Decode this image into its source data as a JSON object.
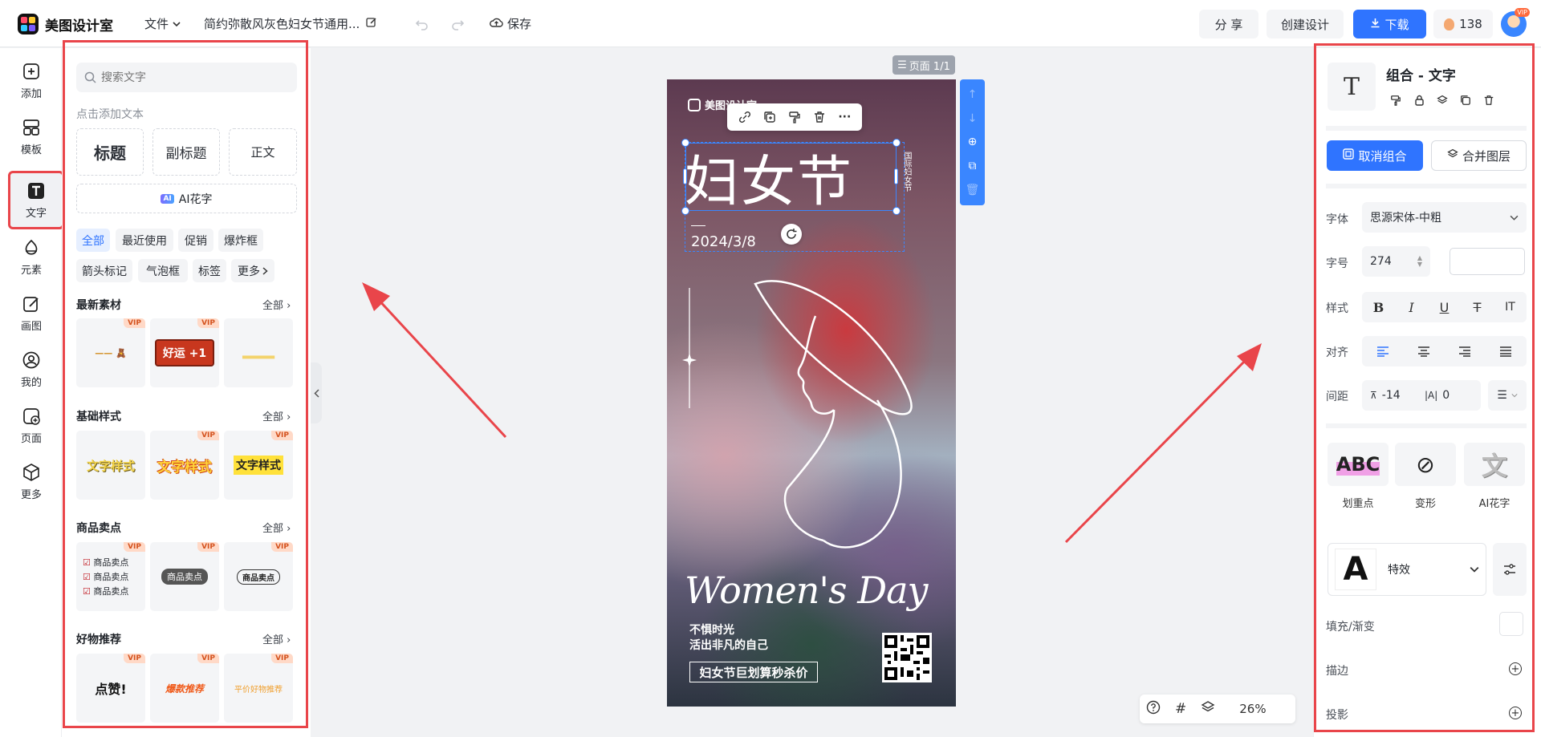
{
  "app": {
    "name": "美图设计室",
    "doc_title": "简约弥散风灰色妇女节通用...",
    "file_menu": "文件",
    "save": "保存"
  },
  "header": {
    "share": "分 享",
    "create": "创建设计",
    "download": "下载",
    "coins": "138",
    "avatar_badge": "VIP"
  },
  "rail": [
    {
      "label": "添加",
      "icon": "plus-square-icon"
    },
    {
      "label": "模板",
      "icon": "template-icon"
    },
    {
      "label": "文字",
      "icon": "text-icon",
      "active": true
    },
    {
      "label": "元素",
      "icon": "shapes-icon"
    },
    {
      "label": "画图",
      "icon": "pen-icon"
    },
    {
      "label": "我的",
      "icon": "user-icon"
    },
    {
      "label": "页面",
      "icon": "page-icon"
    },
    {
      "label": "更多",
      "icon": "box-icon"
    }
  ],
  "text_panel": {
    "search_placeholder": "搜索文字",
    "hint": "点击添加文本",
    "title_btn": "标题",
    "subtitle_btn": "副标题",
    "body_btn": "正文",
    "ai_tag": "AI",
    "ai_btn": "AI花字",
    "chips": [
      "全部",
      "最近使用",
      "促销",
      "爆炸框",
      "箭头标记",
      "气泡框",
      "标签",
      "更多"
    ],
    "sections": [
      {
        "title": "最新素材",
        "all": "全部",
        "tiles": [
          {
            "text": "",
            "vip": "VIP"
          },
          {
            "text": "好运 +1",
            "vip": "VIP"
          },
          {
            "text": ""
          }
        ]
      },
      {
        "title": "基础样式",
        "all": "全部",
        "tiles": [
          {
            "text": "文字样式"
          },
          {
            "text": "文字样式",
            "vip": "VIP"
          },
          {
            "text": "文字样式",
            "vip": "VIP"
          }
        ]
      },
      {
        "title": "商品卖点",
        "all": "全部",
        "tiles": [
          {
            "lines": [
              "商品卖点",
              "商品卖点",
              "商品卖点"
            ],
            "vip": "VIP"
          },
          {
            "text": "商品卖点",
            "vip": "VIP"
          },
          {
            "text": "商品卖点",
            "vip": "VIP"
          }
        ]
      },
      {
        "title": "好物推荐",
        "all": "全部",
        "tiles": [
          {
            "text": "点赞!",
            "vip": "VIP"
          },
          {
            "text": "爆款推荐",
            "vip": "VIP"
          },
          {
            "text": "平价好物推荐",
            "vip": "VIP"
          }
        ]
      }
    ]
  },
  "canvas": {
    "page_indicator": "页面 1/1",
    "zoom": "26%",
    "poster": {
      "brand": "美图设计室",
      "title": "妇女节",
      "vertical_text": "国际妇女节",
      "date": "2024/3/8",
      "english": "Women's Day",
      "slogan_1": "不惧时光",
      "slogan_2": "活出非凡的自己",
      "cta": "妇女节巨划算秒杀价"
    }
  },
  "props": {
    "title": "组合 - 文字",
    "ungroup": "取消组合",
    "merge": "合并图层",
    "font_label": "字体",
    "font_value": "思源宋体-中粗",
    "size_label": "字号",
    "size_value": "274",
    "style_label": "样式",
    "align_label": "对齐",
    "spacing_label": "间距",
    "letter_spacing": "-14",
    "line_spacing": "0",
    "effects": [
      {
        "label": "划重点",
        "glyph": "ABC"
      },
      {
        "label": "变形",
        "glyph": "⊘"
      },
      {
        "label": "AI花字",
        "glyph": "文"
      }
    ],
    "special_effect": "特效",
    "fill_label": "填充/渐变",
    "stroke_label": "描边",
    "shadow_label": "投影"
  },
  "colors": {
    "accent": "#2f74ff",
    "annotation": "#e9454a"
  }
}
